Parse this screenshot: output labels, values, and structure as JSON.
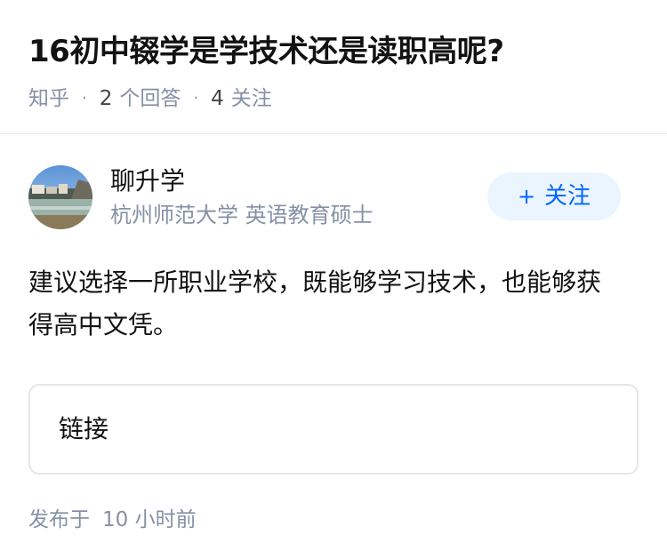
{
  "question": {
    "title": "16初中辍学是学技术还是读职高呢?",
    "source": "知乎",
    "answer_count": "2",
    "answer_label": "个回答",
    "follow_count": "4",
    "follow_label": "关注"
  },
  "answer": {
    "author_name": "聊升学",
    "author_headline": "杭州师范大学 英语教育硕士",
    "follow_button_label": "关注",
    "follow_button_icon": "plus-icon",
    "content": "建议选择一所职业学校，既能够学习技术，也能够获得高中文凭。",
    "link_label": "链接",
    "publish_prefix": "发布于",
    "publish_time": "10 小时前"
  },
  "colors": {
    "accent": "#0066ff",
    "accent_bg": "#ebf5ff",
    "muted_text": "#8590a6",
    "divider": "#ebebeb"
  }
}
